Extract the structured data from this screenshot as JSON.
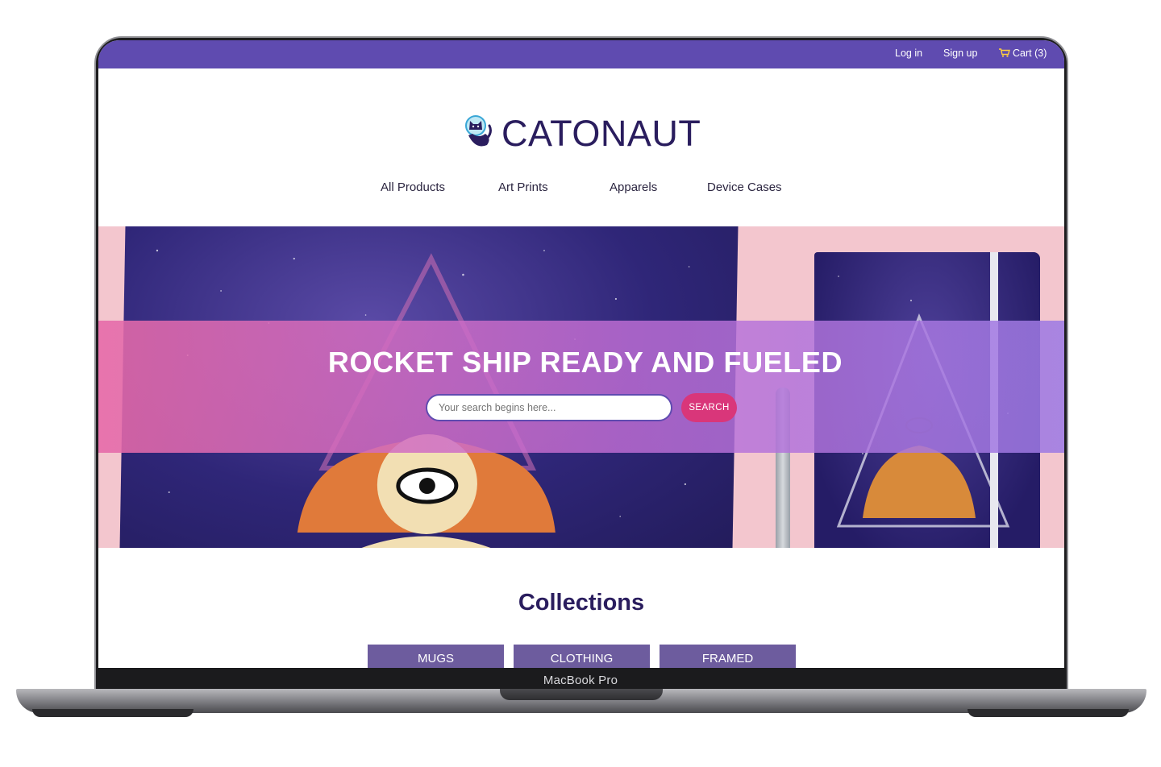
{
  "device": {
    "model_label": "MacBook Pro"
  },
  "topbar": {
    "login": "Log in",
    "signup": "Sign up",
    "cart": "Cart (3)"
  },
  "brand": {
    "name": "CATONAUT",
    "logo_icon": "astronaut-cat-icon"
  },
  "nav": {
    "items": [
      {
        "label": "All Products"
      },
      {
        "label": "Art Prints"
      },
      {
        "label": "Apparels"
      },
      {
        "label": "Device Cases"
      }
    ]
  },
  "hero": {
    "title": "ROCKET SHIP READY AND FUELED",
    "search_placeholder": "Your search begins here...",
    "search_button": "SEARCH"
  },
  "collections": {
    "title": "Collections",
    "tiles": [
      {
        "label": "MUGS"
      },
      {
        "label": "CLOTHING"
      },
      {
        "label": "FRAMED"
      }
    ]
  },
  "colors": {
    "brand_purple": "#5f4bb0",
    "accent_pink": "#d9367a",
    "heading_navy": "#2a1d5e"
  }
}
